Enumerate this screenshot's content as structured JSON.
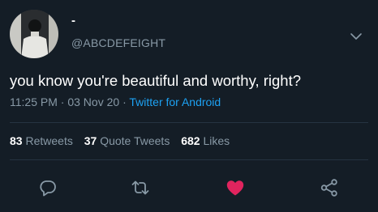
{
  "tweet": {
    "display_name": "-",
    "handle": "@ABCDEFEIGHT",
    "text": "you know you're beautiful and worthy, right?",
    "time": "11:25 PM",
    "separator": "·",
    "date": "03 Nov 20",
    "source": "Twitter for Android"
  },
  "stats": {
    "retweets_count": "83",
    "retweets_label": "Retweets",
    "quotes_count": "37",
    "quotes_label": "Quote Tweets",
    "likes_count": "682",
    "likes_label": "Likes"
  },
  "icons": {
    "reply": "reply-icon",
    "retweet": "retweet-icon",
    "like": "heart-icon",
    "share": "share-icon",
    "menu": "chevron-down-icon"
  },
  "colors": {
    "background": "#141d26",
    "text_primary": "#ffffff",
    "text_secondary": "#8899a6",
    "link": "#1da1f2",
    "like": "#e0245e",
    "divider": "#253341"
  }
}
